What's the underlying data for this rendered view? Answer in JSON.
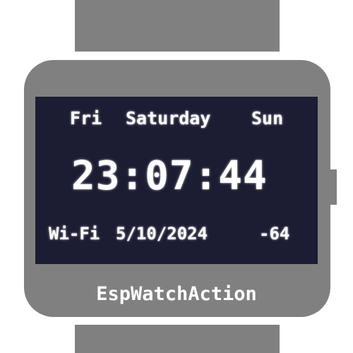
{
  "watch": {
    "prev_day": "Fri",
    "current_day": "Saturday",
    "next_day": "Sun",
    "time": "23:07:44",
    "wifi_label": "Wi-Fi",
    "date": "5/10/2024",
    "signal_strength": "-64",
    "brand": "EspWatchAction"
  },
  "colors": {
    "case": "#808080",
    "screen": "#1c1c33",
    "text": "#ffffff",
    "background": "#ffffff"
  }
}
